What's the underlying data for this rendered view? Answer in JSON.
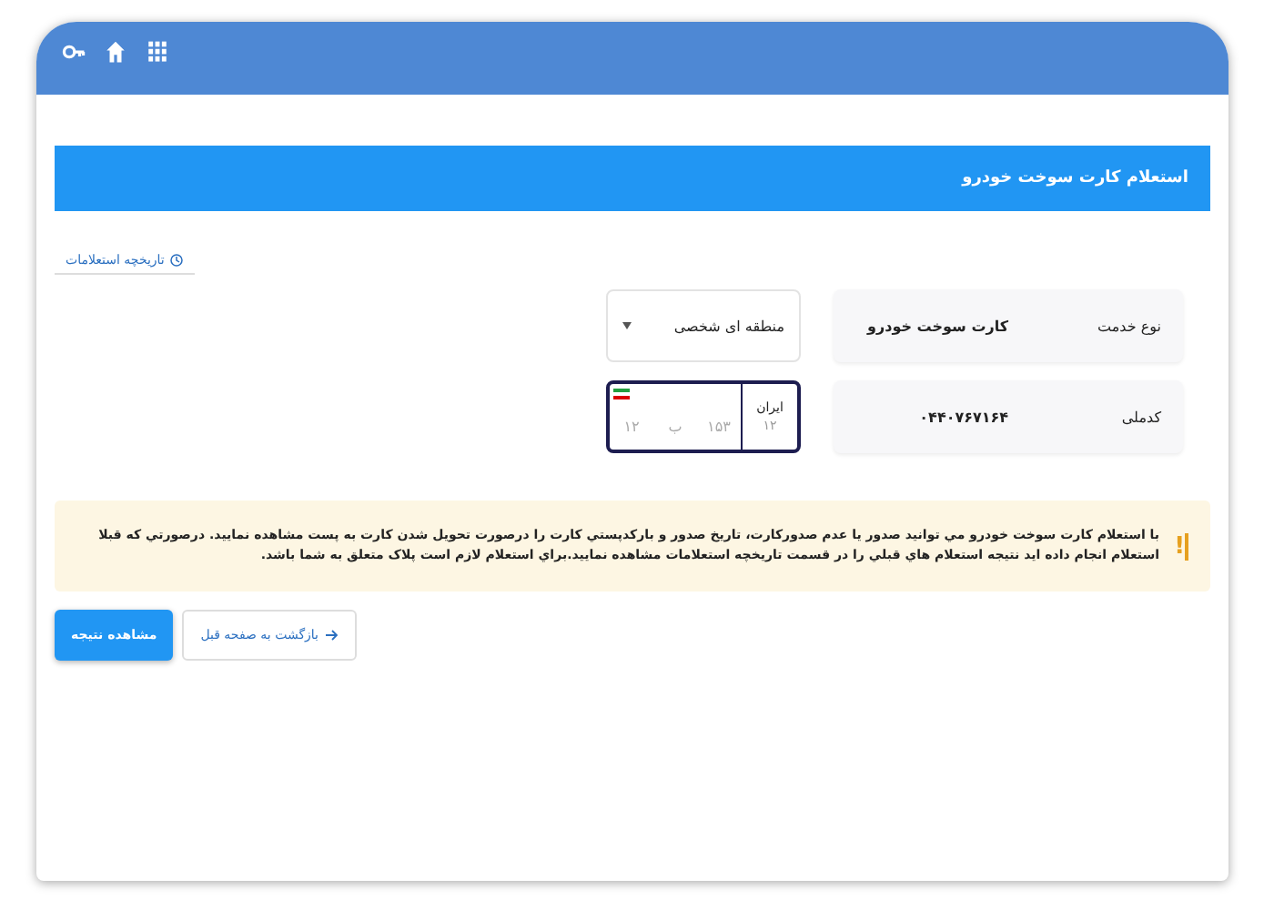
{
  "page_title": "استعلام کارت سوخت خودرو",
  "history_button": "تاریخچه استعلامات",
  "service": {
    "label": "نوع خدمت",
    "value": "کارت سوخت خودرو"
  },
  "region_select": {
    "value": "منطقه ای شخصی"
  },
  "national_id": {
    "label": "کدملی",
    "value": "۰۴۴۰۷۶۷۱۶۴"
  },
  "plate": {
    "focused": true,
    "country": "ایران",
    "region_code": "۱۲",
    "fields": [
      {
        "placeholder": "۱۵۳"
      },
      {
        "placeholder": "ب"
      },
      {
        "placeholder": "۱۲"
      }
    ]
  },
  "alert": {
    "icon": "!",
    "text": "با استعلام کارت سوخت خودرو مي توانيد صدور يا عدم صدورکارت، تاريخ صدور و بارکدپستي کارت را درصورت تحويل شدن کارت به پست مشاهده نماييد. درصورتي که قبلا استعلام انجام داده ايد نتيجه استعلام هاي قبلي را در قسمت تاريخچه استعلامات مشاهده نماييد.براي استعلام لازم است پلاک متعلق به شما باشد."
  },
  "buttons": [
    {
      "kind": "back",
      "label": "بازگشت به صفحه قبل"
    },
    {
      "kind": "primary",
      "label": "مشاهده نتیجه"
    }
  ]
}
